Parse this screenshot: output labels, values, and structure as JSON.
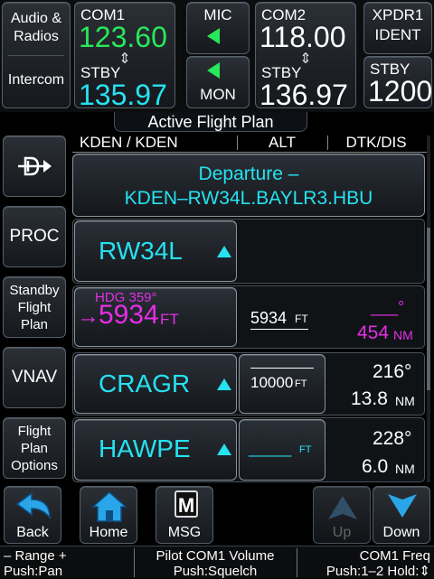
{
  "radio": {
    "audio_label_1": "Audio &",
    "audio_label_2": "Radios",
    "intercom_label": "Intercom",
    "com1": {
      "name": "COM1",
      "active": "123.60",
      "stby_label": "STBY",
      "standby": "135.97"
    },
    "com2": {
      "name": "COM2",
      "active": "118.00",
      "stby_label": "STBY",
      "standby": "136.97"
    },
    "swap_glyph": "⇕",
    "mic_label": "MIC",
    "mon_label": "MON",
    "xpdr_name": "XPDR1",
    "xpdr_mode": "IDENT",
    "xpdr_stby_label": "STBY",
    "xpdr_code": "1200"
  },
  "flight_plan": {
    "title": "Active Flight Plan",
    "route": "KDEN / KDEN",
    "col_alt": "ALT",
    "col_dtk": "DTK/DIS",
    "departure_line1": "Departure –",
    "departure_line2": "KDEN–RW34L.BAYLR3.HBU",
    "rows": [
      {
        "wpt": "RW34L"
      },
      {
        "hdg": "HDG 359°",
        "alt": "5934",
        "alt_unit": "FT",
        "alt_col": "5934",
        "alt_col_unit": "FT",
        "dtk": "___°",
        "dis": "454",
        "dis_unit": "NM"
      },
      {
        "wpt": "CRAGR",
        "alt": "10000",
        "alt_unit": "FT",
        "dtk": "216°",
        "dis": "13.8",
        "dis_unit": "NM"
      },
      {
        "wpt": "HAWPE",
        "alt": "_____",
        "alt_unit": "FT",
        "dtk": "228°",
        "dis": "6.0",
        "dis_unit": "NM"
      }
    ]
  },
  "side_buttons": {
    "proc": "PROC",
    "standby_1": "Standby",
    "standby_2": "Flight",
    "standby_3": "Plan",
    "vnav": "VNAV",
    "options_1": "Flight",
    "options_2": "Plan",
    "options_3": "Options"
  },
  "bottom": {
    "back": "Back",
    "home": "Home",
    "msg": "MSG",
    "msg_icon_letter": "M",
    "up": "Up",
    "down": "Down"
  },
  "status": {
    "left_1": "– Range +",
    "left_2": "Push:Pan",
    "mid_1": "Pilot COM1 Volume",
    "mid_2": "Push:Squelch",
    "right_1": "COM1 Freq",
    "right_2": "Push:1–2 Hold:⇕"
  },
  "colors": {
    "cyan": "#26e2f0",
    "green": "#27e85a",
    "magenta": "#e62ee6"
  }
}
